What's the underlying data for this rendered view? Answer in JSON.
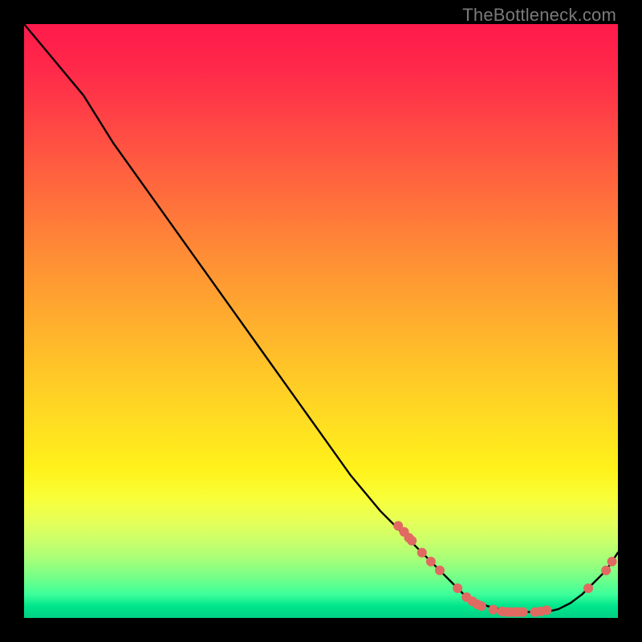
{
  "watermark": "TheBottleneck.com",
  "colors": {
    "dot": "#e06a62",
    "curve": "#000000",
    "frame_bg": "#000000"
  },
  "chart_data": {
    "type": "line",
    "title": "",
    "xlabel": "",
    "ylabel": "",
    "xrange": [
      0,
      100
    ],
    "yrange": [
      0,
      100
    ],
    "curve": {
      "name": "bottleneck-curve",
      "x": [
        0,
        5,
        10,
        15,
        20,
        25,
        30,
        35,
        40,
        45,
        50,
        55,
        60,
        62,
        64,
        66,
        68,
        70,
        72,
        74,
        76,
        78,
        80,
        82,
        84,
        86,
        88,
        90,
        92,
        94,
        96,
        98,
        100
      ],
      "y": [
        100,
        94,
        88,
        80,
        73,
        66,
        59,
        52,
        45,
        38,
        31,
        24,
        18,
        16,
        14,
        12,
        10,
        8,
        6,
        4,
        3,
        2,
        1.5,
        1,
        1,
        1,
        1,
        1.5,
        2.5,
        4,
        6,
        8,
        11
      ]
    },
    "dots": {
      "name": "sample-points",
      "points": [
        {
          "x": 63,
          "y": 15.5
        },
        {
          "x": 64,
          "y": 14.5
        },
        {
          "x": 64.8,
          "y": 13.5
        },
        {
          "x": 65.3,
          "y": 13
        },
        {
          "x": 67,
          "y": 11
        },
        {
          "x": 68.5,
          "y": 9.5
        },
        {
          "x": 70,
          "y": 8
        },
        {
          "x": 73,
          "y": 5
        },
        {
          "x": 74.5,
          "y": 3.5
        },
        {
          "x": 75.5,
          "y": 2.8
        },
        {
          "x": 76.3,
          "y": 2.3
        },
        {
          "x": 77,
          "y": 2
        },
        {
          "x": 79,
          "y": 1.4
        },
        {
          "x": 80.5,
          "y": 1.1
        },
        {
          "x": 81.3,
          "y": 1
        },
        {
          "x": 82,
          "y": 1
        },
        {
          "x": 82.7,
          "y": 1
        },
        {
          "x": 83.3,
          "y": 1
        },
        {
          "x": 84,
          "y": 1
        },
        {
          "x": 86,
          "y": 1
        },
        {
          "x": 87,
          "y": 1.1
        },
        {
          "x": 88,
          "y": 1.3
        },
        {
          "x": 95,
          "y": 5
        },
        {
          "x": 98,
          "y": 8
        },
        {
          "x": 99,
          "y": 9.5
        }
      ],
      "radius": 6
    }
  }
}
